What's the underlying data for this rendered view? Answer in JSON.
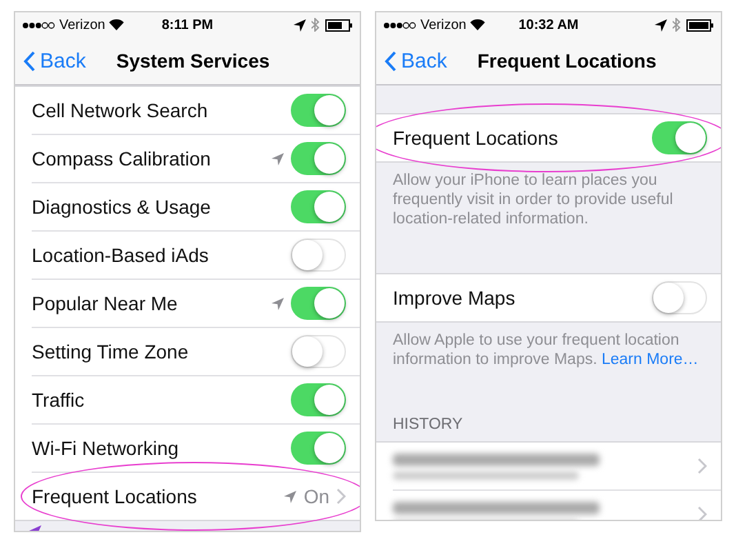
{
  "screens": [
    {
      "status_bar": {
        "carrier": "Verizon",
        "time": "8:11 PM"
      },
      "nav": {
        "back": "Back",
        "title": "System Services"
      },
      "sections": [
        {
          "rows": [
            {
              "kind": "toggle",
              "label": "Cell Network Search",
              "on": true,
              "location_icon": false,
              "circled": false
            },
            {
              "kind": "toggle",
              "label": "Compass Calibration",
              "on": true,
              "location_icon": true,
              "circled": false
            },
            {
              "kind": "toggle",
              "label": "Diagnostics & Usage",
              "on": true,
              "location_icon": false,
              "circled": false
            },
            {
              "kind": "toggle",
              "label": "Location-Based iAds",
              "on": false,
              "location_icon": false,
              "circled": false
            },
            {
              "kind": "toggle",
              "label": "Popular Near Me",
              "on": true,
              "location_icon": true,
              "circled": false
            },
            {
              "kind": "toggle",
              "label": "Setting Time Zone",
              "on": false,
              "location_icon": false,
              "circled": false
            },
            {
              "kind": "toggle",
              "label": "Traffic",
              "on": true,
              "location_icon": false,
              "circled": false
            },
            {
              "kind": "toggle",
              "label": "Wi-Fi Networking",
              "on": true,
              "location_icon": false,
              "circled": false
            },
            {
              "kind": "disclosure",
              "label": "Frequent Locations",
              "value": "On",
              "location_icon": true,
              "circled": true
            }
          ],
          "footer_icon": true
        }
      ]
    },
    {
      "status_bar": {
        "carrier": "Verizon",
        "time": "10:32 AM"
      },
      "nav": {
        "back": "Back",
        "title": "Frequent Locations"
      },
      "sections": [
        {
          "rows": [
            {
              "kind": "toggle",
              "label": "Frequent Locations",
              "on": true,
              "location_icon": false,
              "circled": true
            }
          ],
          "footer": "Allow your iPhone to learn places you frequently visit in order to provide useful location-related information."
        },
        {
          "rows": [
            {
              "kind": "toggle",
              "label": "Improve Maps",
              "on": false,
              "location_icon": false,
              "circled": false
            }
          ],
          "footer": "Allow Apple to use your frequent location information to improve Maps.",
          "footer_link": "Learn More…"
        },
        {
          "header": "HISTORY",
          "rows": [
            {
              "kind": "blurred",
              "circled": false
            },
            {
              "kind": "blurred",
              "circled": false
            }
          ]
        }
      ]
    }
  ]
}
